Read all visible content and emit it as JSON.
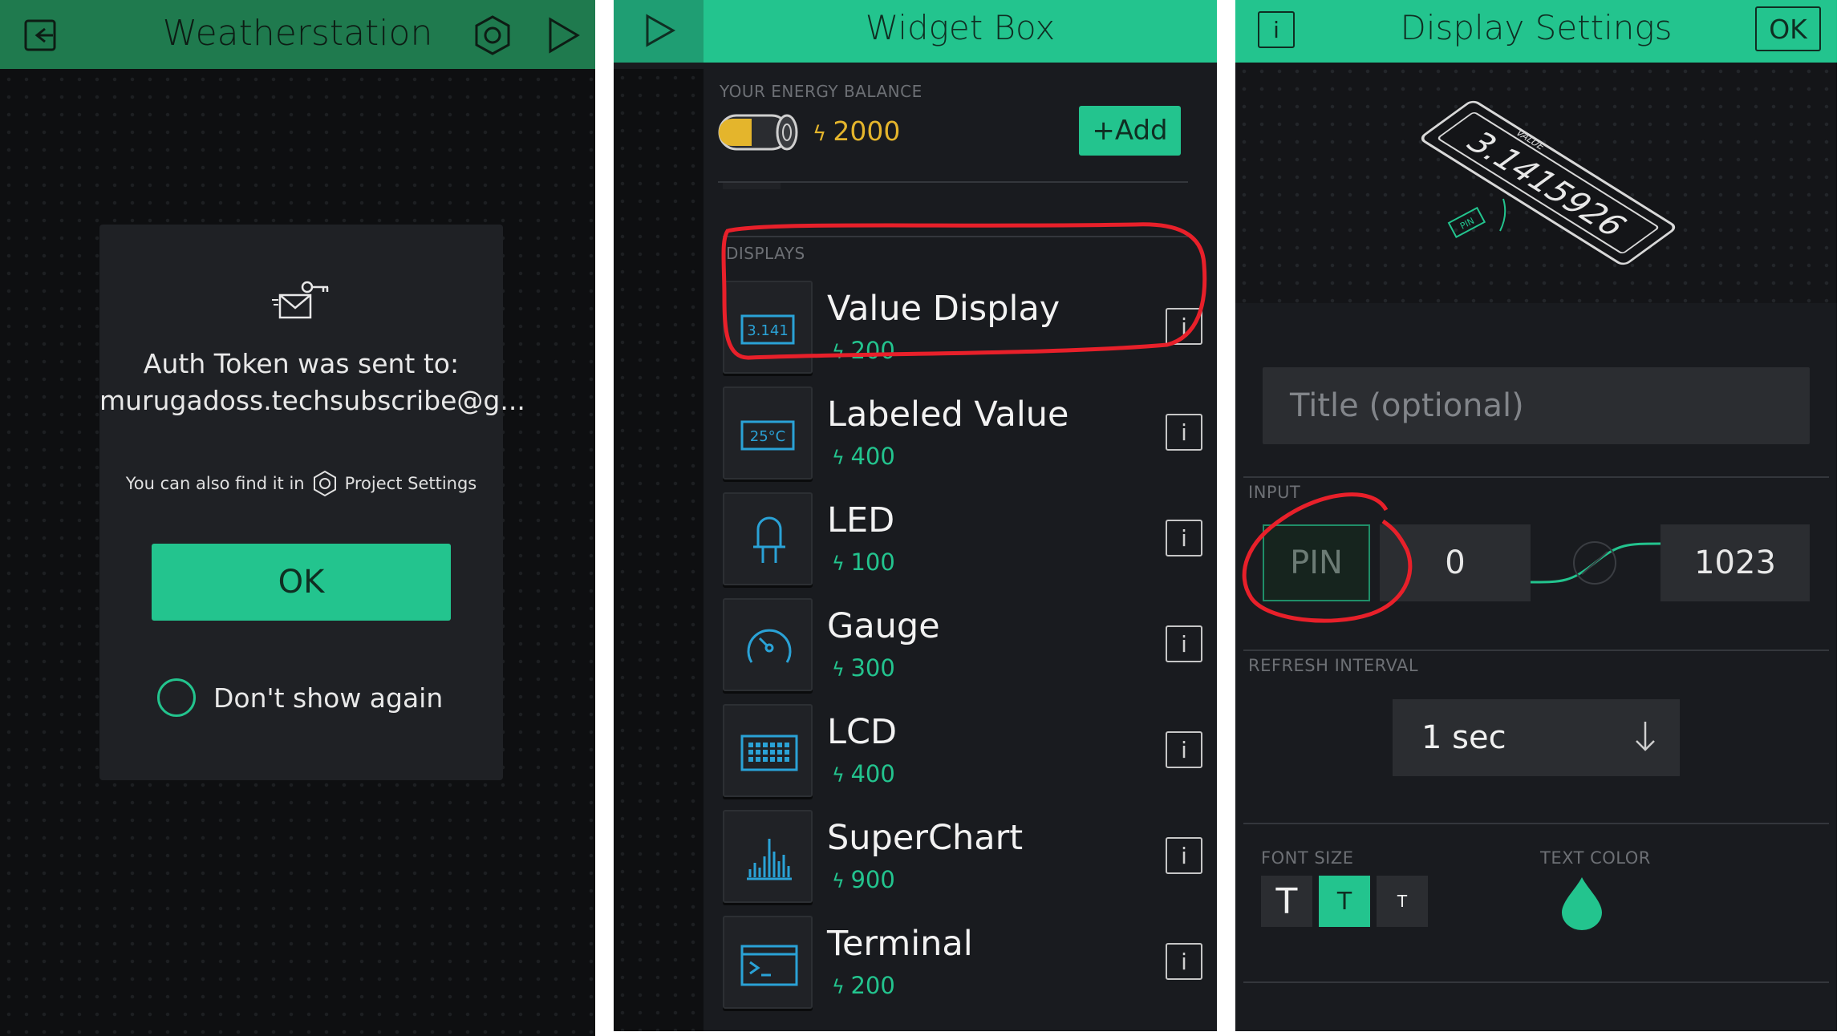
{
  "panel1": {
    "title": "Weatherstation",
    "icons": {
      "back": "exit-icon",
      "settings": "hexagon-settings-icon",
      "play": "play-icon"
    },
    "dialog": {
      "icon": "mail-key-icon",
      "line1": "Auth Token was sent to:",
      "line2": "murugadoss.techsubscribe@g...",
      "hint_prefix": "You can also find it in",
      "hint_suffix": "Project Settings",
      "ok_label": "OK",
      "checkbox_label": "Don't show again"
    }
  },
  "panel2": {
    "title": "Widget Box",
    "energy_label": "YOUR ENERGY BALANCE",
    "energy_value": "2000",
    "add_label": "+Add",
    "section_label": "DISPLAYS",
    "widgets": [
      {
        "name": "Value Display",
        "cost": "200",
        "icon": "value-display-icon",
        "icon_text": "3.141"
      },
      {
        "name": "Labeled Value",
        "cost": "400",
        "icon": "labeled-value-icon",
        "icon_text": "25°C"
      },
      {
        "name": "LED",
        "cost": "100",
        "icon": "led-icon"
      },
      {
        "name": "Gauge",
        "cost": "300",
        "icon": "gauge-icon"
      },
      {
        "name": "LCD",
        "cost": "400",
        "icon": "lcd-icon"
      },
      {
        "name": "SuperChart",
        "cost": "900",
        "icon": "superchart-icon"
      },
      {
        "name": "Terminal",
        "cost": "200",
        "icon": "terminal-icon"
      }
    ],
    "info_label": "i"
  },
  "panel3": {
    "title": "Display Settings",
    "info_label": "i",
    "ok_label": "OK",
    "preview": {
      "value_text": "3.1415926",
      "value_tag": "VALUE",
      "pin_tag": "PIN"
    },
    "title_placeholder": "Title (optional)",
    "input_label": "INPUT",
    "pin_label": "PIN",
    "range_min": "0",
    "range_max": "1023",
    "refresh_label": "REFRESH INTERVAL",
    "refresh_value": "1 sec",
    "font_size_label": "FONT SIZE",
    "font_sizes": [
      "T",
      "T",
      "T"
    ],
    "text_color_label": "TEXT COLOR"
  },
  "colors": {
    "accent": "#23c48e",
    "header_dark": "#1f7a4e",
    "energy": "#e4b52c",
    "annotation": "#e8202a"
  }
}
